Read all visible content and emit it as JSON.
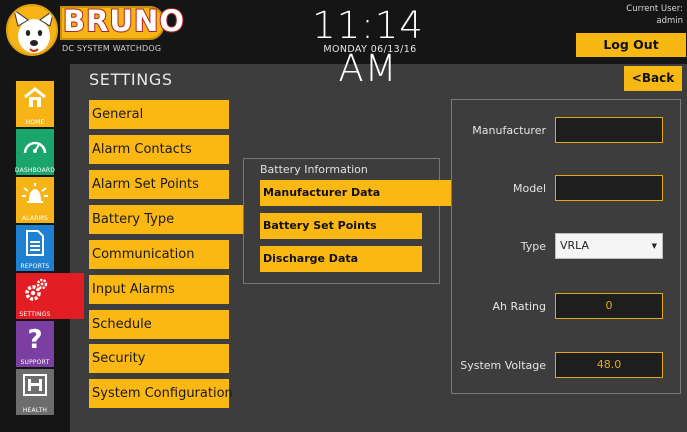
{
  "header": {
    "brand": "BRUNO",
    "brand_sub": "DC SYSTEM WATCHDOG",
    "time": "11:14 AM",
    "date": "MONDAY 06/13/16",
    "current_user_label": "Current User:",
    "current_user": "admin",
    "logout_label": "Log Out",
    "accent_color": "#f8b814"
  },
  "sidebar": {
    "items": [
      {
        "label": "HOME",
        "icon": "home-icon",
        "color": "#f6b417"
      },
      {
        "label": "DASHBOARD",
        "icon": "gauge-icon",
        "color": "#1aa56a"
      },
      {
        "label": "ALARMS",
        "icon": "alarm-bell-icon",
        "color": "#f6b417"
      },
      {
        "label": "REPORTS",
        "icon": "document-icon",
        "color": "#1f7fd0"
      },
      {
        "label": "SETTINGS",
        "icon": "gears-icon",
        "color": "#e31d24",
        "active": true
      },
      {
        "label": "SUPPORT",
        "icon": "question-icon",
        "color": "#7a3fa0"
      },
      {
        "label": "HEALTH",
        "icon": "health-icon",
        "color": "#6d6d6d"
      }
    ]
  },
  "page": {
    "title": "SETTINGS",
    "back_label": "<Back"
  },
  "menu": {
    "items": [
      {
        "label": "General"
      },
      {
        "label": "Alarm Contacts"
      },
      {
        "label": "Alarm Set Points"
      },
      {
        "label": "Battery Type",
        "active": true
      },
      {
        "label": "Communication"
      },
      {
        "label": "Input Alarms"
      },
      {
        "label": "Schedule"
      },
      {
        "label": "Security"
      },
      {
        "label": "System Configuration"
      }
    ]
  },
  "battery": {
    "title": "Battery Information",
    "buttons": [
      {
        "label": "Manufacturer Data",
        "active": true
      },
      {
        "label": "Battery Set Points"
      },
      {
        "label": "Discharge Data"
      }
    ]
  },
  "form": {
    "manufacturer_label": "Manufacturer",
    "manufacturer_value": "",
    "model_label": "Model",
    "model_value": "",
    "type_label": "Type",
    "type_value": "VRLA",
    "ah_label": "Ah Rating",
    "ah_value": "0",
    "voltage_label": "System Voltage",
    "voltage_value": "48.0"
  }
}
